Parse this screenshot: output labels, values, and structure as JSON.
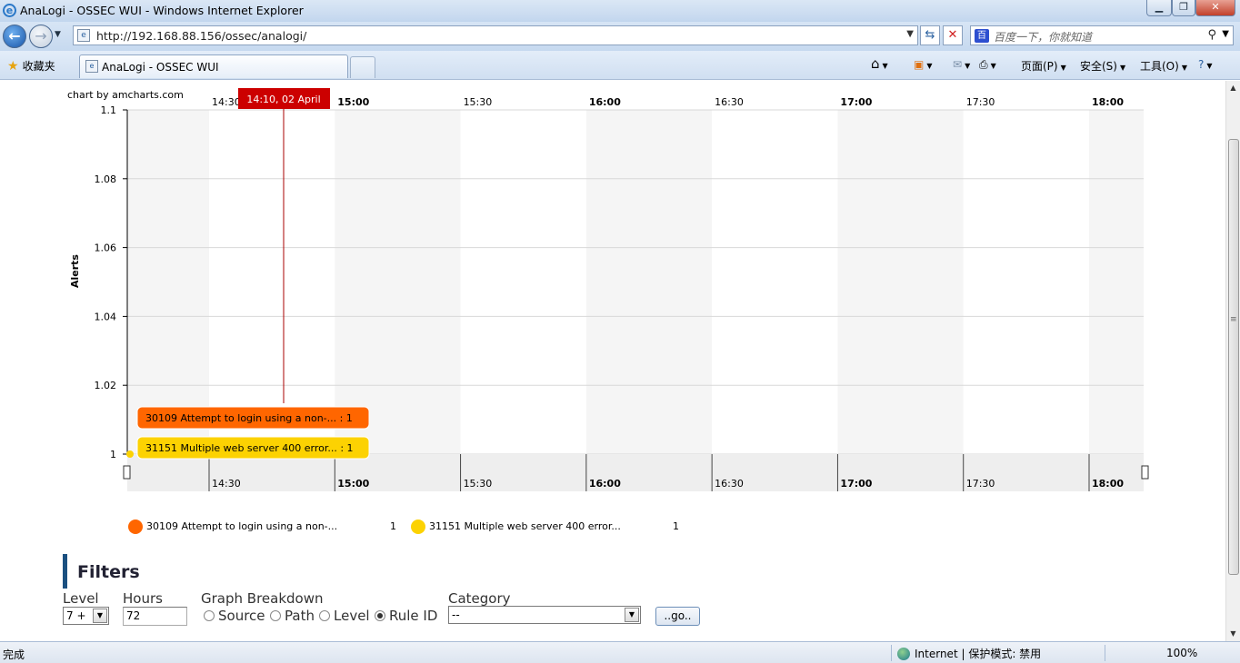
{
  "window": {
    "title": "AnaLogi - OSSEC WUI - Windows Internet Explorer"
  },
  "toolbar": {
    "url": "http://192.168.88.156/ossec/analogi/",
    "search_placeholder": "百度一下，你就知道",
    "favorites_label": "收藏夹",
    "tab_title": "AnaLogi - OSSEC WUI",
    "commands": [
      "页面(P)",
      "安全(S)",
      "工具(O)"
    ]
  },
  "chart_data": {
    "type": "line",
    "credit": "chart by amcharts.com",
    "ylabel": "Alerts",
    "xlabel": "",
    "ylim": [
      1,
      1.1
    ],
    "yticks": [
      "1.1",
      "1.08",
      "1.06",
      "1.04",
      "1.02",
      "1"
    ],
    "xticks": [
      {
        "label": "14:30",
        "bold": false
      },
      {
        "label": "15:00",
        "bold": true
      },
      {
        "label": "15:30",
        "bold": false
      },
      {
        "label": "16:00",
        "bold": true
      },
      {
        "label": "16:30",
        "bold": false
      },
      {
        "label": "17:00",
        "bold": true
      },
      {
        "label": "17:30",
        "bold": false
      },
      {
        "label": "18:00",
        "bold": true
      }
    ],
    "cursor_label": "14:10, 02 April",
    "series": [
      {
        "name": "30109 Attempt to login using a non-...",
        "color": "#ff6600",
        "balloon": "30109 Attempt to login using a non-... : 1",
        "x": [
          "14:10"
        ],
        "values": [
          1
        ]
      },
      {
        "name": "31151 Multiple web server 400 error...",
        "color": "#fcd202",
        "balloon": "31151 Multiple web server 400 error... : 1",
        "x": [
          "14:10"
        ],
        "values": [
          1
        ]
      }
    ],
    "legend": [
      {
        "label": "30109 Attempt to login using a non-...",
        "value": "1",
        "color": "#ff6600"
      },
      {
        "label": "31151 Multiple web server 400 error...",
        "value": "1",
        "color": "#fcd202"
      }
    ]
  },
  "filters": {
    "title": "Filters",
    "level_label": "Level",
    "level_value": "7 +",
    "hours_label": "Hours",
    "hours_value": "72",
    "breakdown_label": "Graph Breakdown",
    "breakdown_options": [
      "Source",
      "Path",
      "Level",
      "Rule ID"
    ],
    "breakdown_selected": "Rule ID",
    "category_label": "Category",
    "category_value": "--",
    "go_label": "..go.."
  },
  "status": {
    "text": "完成",
    "zone": "Internet | 保护模式: 禁用",
    "zoom": "100%"
  }
}
